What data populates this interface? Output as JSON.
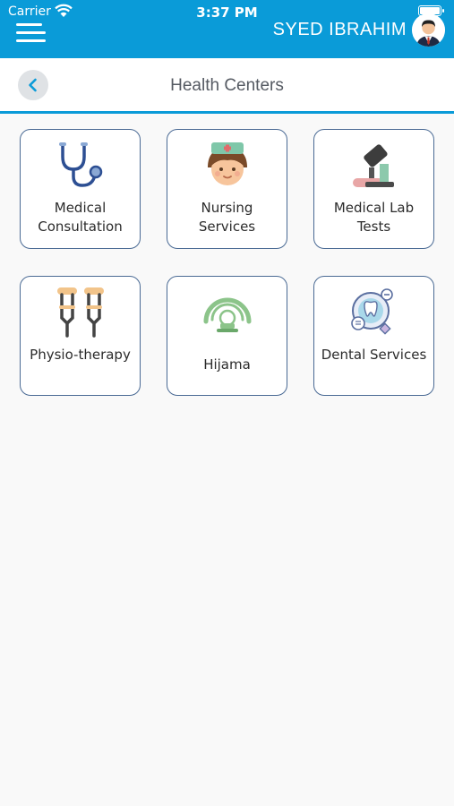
{
  "status": {
    "carrier": "Carrier",
    "time": "3:37 PM"
  },
  "header": {
    "user_name": "SYED IBRAHIM"
  },
  "page": {
    "title": "Health Centers"
  },
  "services": [
    {
      "label": "Medical Consultation",
      "icon": "stethoscope-icon"
    },
    {
      "label": "Nursing Services",
      "icon": "nurse-icon"
    },
    {
      "label": "Medical Lab Tests",
      "icon": "microscope-icon"
    },
    {
      "label": "Physio-therapy",
      "icon": "crutches-icon"
    },
    {
      "label": "Hijama",
      "icon": "scanner-icon"
    },
    {
      "label": "Dental Services",
      "icon": "tooth-icon"
    }
  ],
  "colors": {
    "accent": "#0a9bd8",
    "card_border": "#4a6a94",
    "background": "#f9f9f9"
  }
}
